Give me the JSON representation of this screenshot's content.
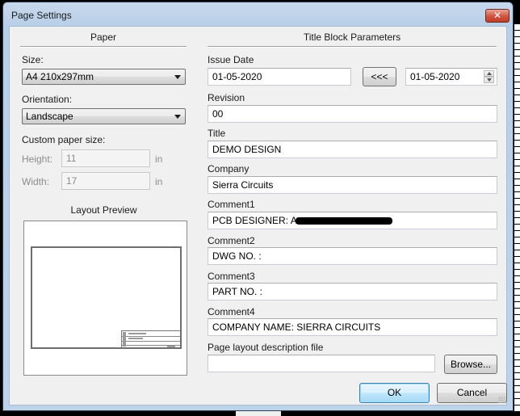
{
  "window": {
    "title": "Page Settings",
    "close_label": "✕"
  },
  "paper": {
    "section_title": "Paper",
    "size_label": "Size:",
    "size_value": "A4 210x297mm",
    "orientation_label": "Orientation:",
    "orientation_value": "Landscape",
    "custom_size_label": "Custom paper size:",
    "height_label": "Height:",
    "height_value": "11",
    "height_unit": "in",
    "width_label": "Width:",
    "width_value": "17",
    "width_unit": "in",
    "preview_title": "Layout Preview"
  },
  "title_block": {
    "section_title": "Title Block Parameters",
    "issue_date_label": "Issue Date",
    "issue_date_value": "01-05-2020",
    "copy_date_button": "<<<",
    "date_picker_value": "01-05-2020",
    "revision_label": "Revision",
    "revision_value": "00",
    "title_label": "Title",
    "title_value": "DEMO DESIGN",
    "company_label": "Company",
    "company_value": "Sierra Circuits",
    "comment1_label": "Comment1",
    "comment1_value": "PCB DESIGNER: A",
    "comment2_label": "Comment2",
    "comment2_value": "DWG NO. :",
    "comment3_label": "Comment3",
    "comment3_value": "PART NO. :",
    "comment4_label": "Comment4",
    "comment4_value": "COMPANY NAME: SIERRA CIRCUITS",
    "layout_file_label": "Page layout description file",
    "layout_file_value": "",
    "browse_button": "Browse..."
  },
  "buttons": {
    "ok": "OK",
    "cancel": "Cancel"
  }
}
